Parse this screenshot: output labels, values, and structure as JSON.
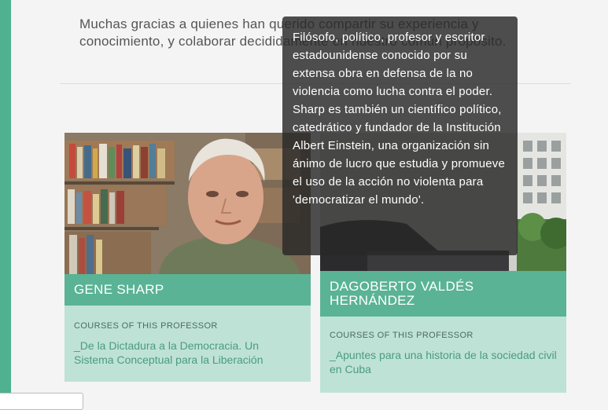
{
  "intro": {
    "text": "Muchas gracias a quienes han querido compartir su experiencia y conocimiento, y colaborar decididamente en nuestro común propósito."
  },
  "professors": [
    {
      "name": "GENE SHARP",
      "courses_label": "COURSES OF THIS PROFESSOR",
      "course": "_De la Dictadura a la Democracia. Un Sistema Conceptual para la Liberación"
    },
    {
      "name": "DAGOBERTO VALDÉS HERNÁNDEZ",
      "courses_label": "COURSES OF THIS PROFESSOR",
      "course": "_Apuntes para una historia de la sociedad civil en Cuba"
    }
  ],
  "tooltip": {
    "text": "Filósofo, político, profesor y escritor estadounidense conocido por su extensa obra en defensa de la no violencia como lucha contra el poder. Sharp es también un científico político, catedrático y fundador de la Institución Albert Einstein, una organización sin ánimo de lucro que estudia y promueve el uso de la acción no violenta para 'democratizar el mundo'."
  },
  "colors": {
    "accent": "#5ab395",
    "accent_light": "#bfe2d6",
    "side_bar": "#4fb18f",
    "tooltip_bg": "#282828"
  }
}
